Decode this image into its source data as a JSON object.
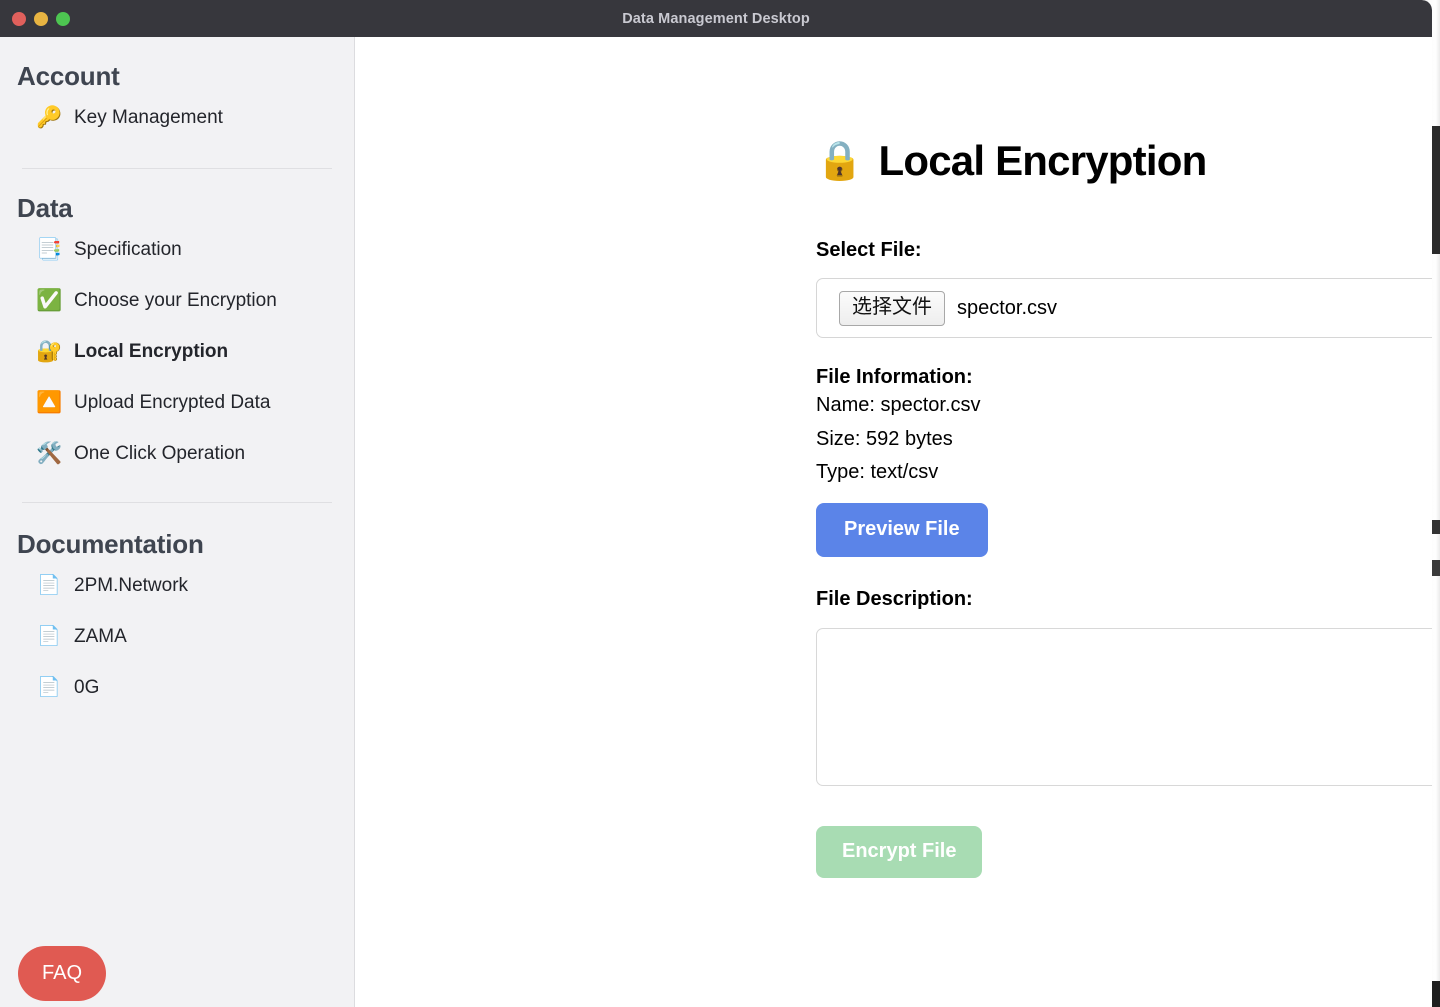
{
  "window": {
    "title": "Data Management Desktop",
    "traffic_lights": [
      {
        "name": "close",
        "color": "#e0605c"
      },
      {
        "name": "minimize",
        "color": "#e8b442"
      },
      {
        "name": "maximize",
        "color": "#4dc551"
      }
    ]
  },
  "sidebar": {
    "sections": [
      {
        "title": "Account",
        "items": [
          {
            "icon": "key-icon",
            "glyph": "🔑",
            "label": "Key Management",
            "active": false
          }
        ]
      },
      {
        "title": "Data",
        "items": [
          {
            "icon": "page-icon",
            "glyph": "📑",
            "label": "Specification",
            "active": false
          },
          {
            "icon": "check-mark-icon",
            "glyph": "✅",
            "label": "Choose your Encryption",
            "active": false
          },
          {
            "icon": "locked-with-key-icon",
            "glyph": "🔐",
            "label": "Local Encryption",
            "active": true
          },
          {
            "icon": "upload-icon",
            "glyph": "🔼",
            "label": "Upload Encrypted Data",
            "active": false
          },
          {
            "icon": "hammer-and-wrench-icon",
            "glyph": "🛠️",
            "label": "One Click Operation",
            "active": false
          }
        ]
      },
      {
        "title": "Documentation",
        "items": [
          {
            "icon": "document-icon",
            "glyph": "📄",
            "label": "2PM.Network",
            "active": false
          },
          {
            "icon": "document-icon",
            "glyph": "📄",
            "label": "ZAMA",
            "active": false
          },
          {
            "icon": "document-icon",
            "glyph": "📄",
            "label": "0G",
            "active": false
          }
        ]
      }
    ],
    "faq_label": "FAQ",
    "faq_color": "#e05a52"
  },
  "main": {
    "page_title": "Local Encryption",
    "page_title_icon": "lock-icon",
    "page_title_glyph": "🔒",
    "select_file_label": "Select File:",
    "choose_file_button": "选择文件",
    "selected_file_name": "spector.csv",
    "file_information_label": "File Information:",
    "file_info": {
      "name_line": "Name: spector.csv",
      "size_line": "Size: 592 bytes",
      "type_line": "Type: text/csv"
    },
    "preview_button": "Preview File",
    "preview_button_color": "#5b84e8",
    "file_description_label": "File Description:",
    "description_value": "",
    "description_placeholder": "",
    "encrypt_button": "Encrypt File",
    "encrypt_button_color": "#a8dcb3"
  }
}
